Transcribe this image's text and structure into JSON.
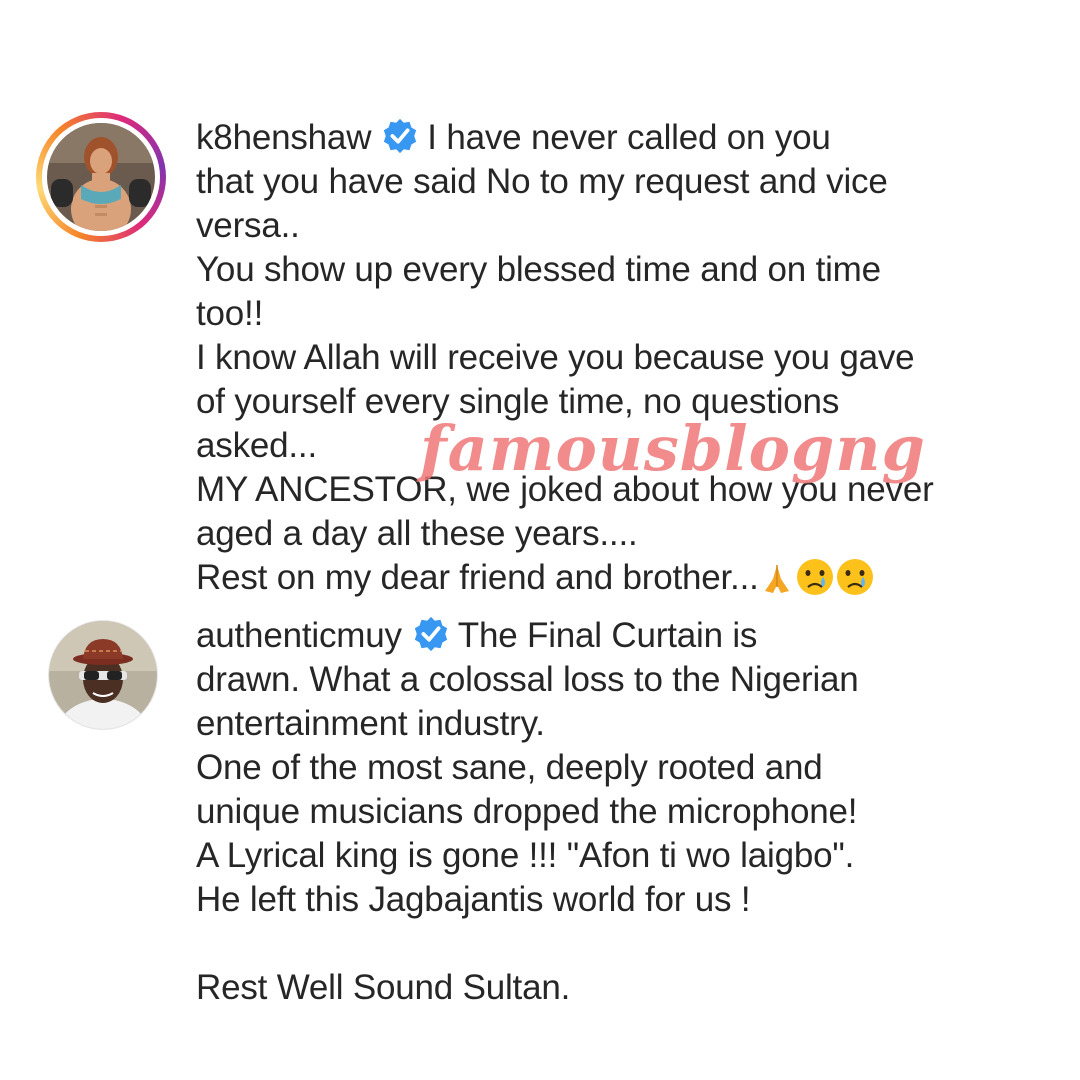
{
  "comments": [
    {
      "username": "k8henshaw",
      "verified": true,
      "avatar_icon": "woman-athlete-avatar",
      "text": "I have never called on you\nthat you have said No to my request and vice\nversa..\nYou show up every blessed time and on time\ntoo!!\nI know Allah will receive you because you gave\nof yourself every single time, no questions\nasked...\nMY ANCESTOR, we joked about how you never\naged a day all these years....\nRest on my dear friend and brother...",
      "emojis": [
        "folded-hands-icon",
        "crying-face-icon",
        "crying-face-icon"
      ]
    },
    {
      "username": "authenticmuy",
      "verified": true,
      "avatar_icon": "man-with-hat-avatar",
      "text": "The Final Curtain is\ndrawn. What a colossal loss to the Nigerian\nentertainment industry.\nOne of the most sane, deeply rooted and\nunique musicians dropped the microphone!\nA Lyrical king is gone !!! \"Afon ti wo laigbo\".\nHe left this Jagbajantis world for us !\n\nRest Well Sound Sultan."
    }
  ],
  "watermark": "famousblogng",
  "colors": {
    "text": "#262626",
    "verified": "#3897f0",
    "watermark": "#f07878"
  }
}
